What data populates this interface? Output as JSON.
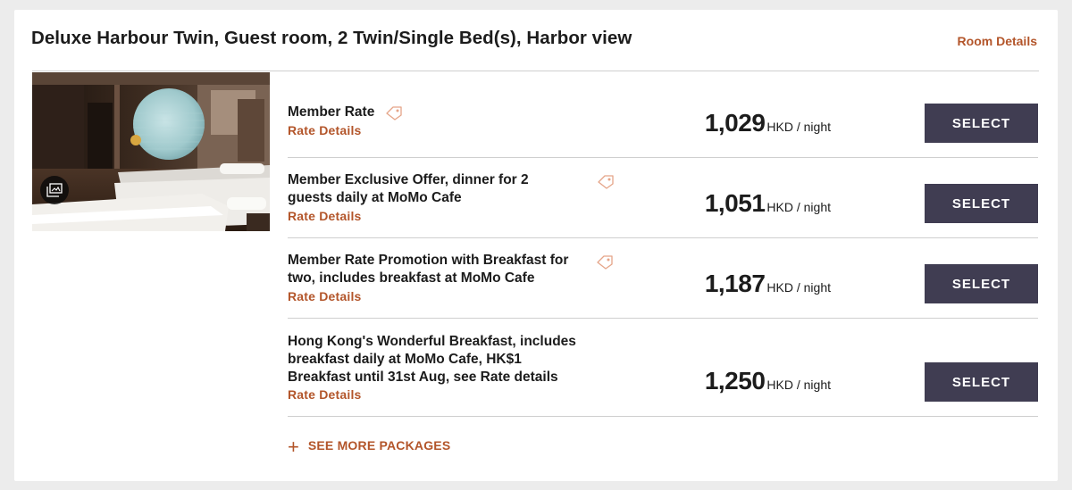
{
  "room": {
    "title": "Deluxe Harbour Twin, Guest room, 2 Twin/Single Bed(s), Harbor view",
    "details_link": "Room Details"
  },
  "rates": [
    {
      "name_lines": [
        "Member Rate"
      ],
      "details_link": "Rate Details",
      "price": "1,029",
      "unit": "HKD / night",
      "select_label": "SELECT",
      "has_tag": true
    },
    {
      "name_lines": [
        "Member Exclusive Offer, dinner for 2",
        "guests daily at MoMo Cafe"
      ],
      "details_link": "Rate Details",
      "price": "1,051",
      "unit": "HKD / night",
      "select_label": "SELECT",
      "has_tag": true
    },
    {
      "name_lines": [
        "Member Rate Promotion with Breakfast for",
        "two, includes breakfast at MoMo Cafe"
      ],
      "details_link": "Rate Details",
      "price": "1,187",
      "unit": "HKD / night",
      "select_label": "SELECT",
      "has_tag": true
    },
    {
      "name_lines": [
        "Hong Kong's Wonderful Breakfast, includes",
        "breakfast daily at MoMo Cafe, HK$1",
        "Breakfast until 31st Aug, see Rate details"
      ],
      "details_link": "Rate Details",
      "price": "1,250",
      "unit": "HKD / night",
      "select_label": "SELECT",
      "has_tag": false
    }
  ],
  "see_more": {
    "icon": "plus-icon",
    "label": "SEE MORE PACKAGES"
  },
  "icons": {
    "gallery": "photo-gallery-icon",
    "tag": "member-tag-icon"
  },
  "colors": {
    "accent": "#b3552a",
    "button": "#403d52",
    "background": "#ececec",
    "divider": "#cfcfcf"
  }
}
